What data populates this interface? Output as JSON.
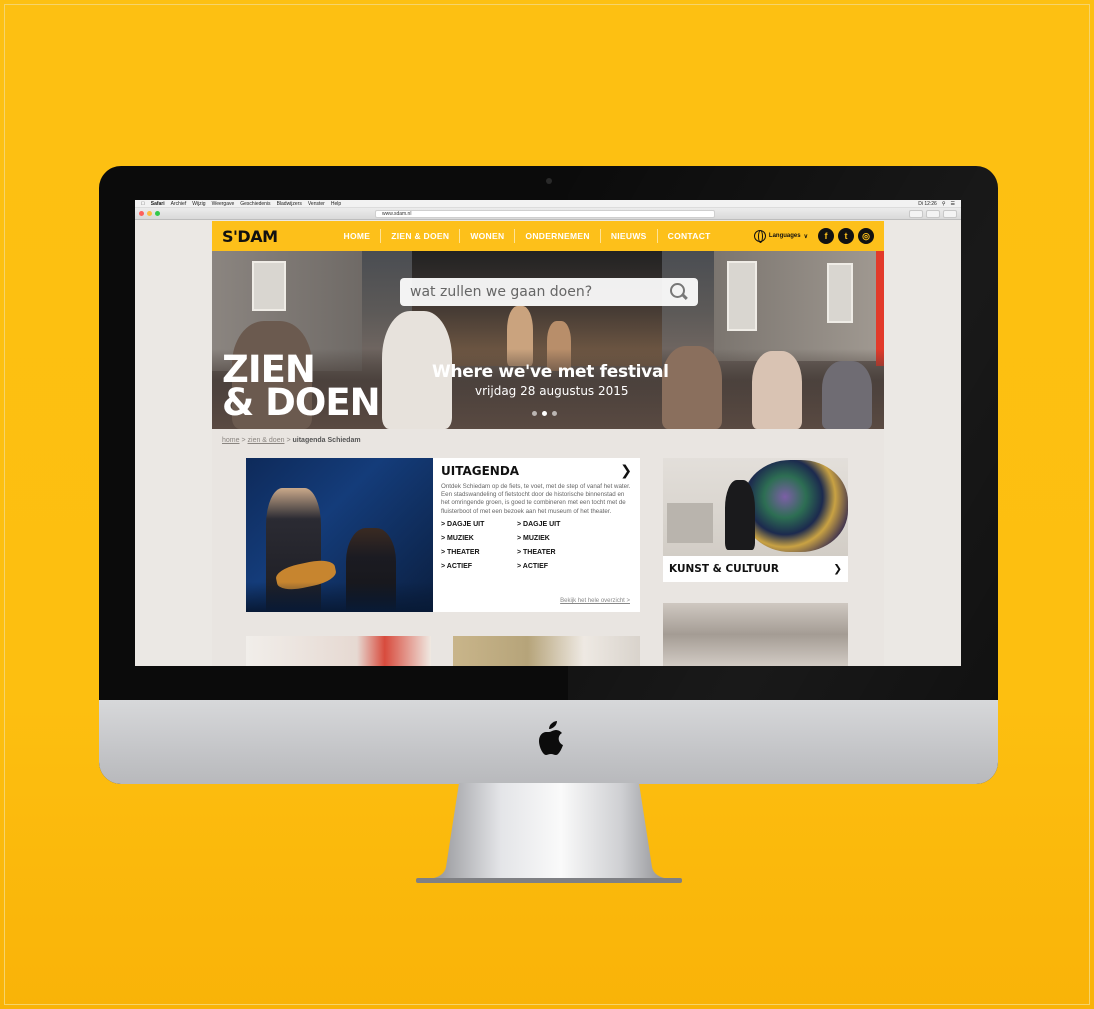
{
  "mac_menubar": {
    "app": "Safari",
    "items": [
      "Archief",
      "Wijzig",
      "Weergave",
      "Geschiedenis",
      "Bladwijzers",
      "Venster",
      "Help"
    ],
    "clock": "Di 12:26"
  },
  "browser": {
    "url": "www.sdam.nl"
  },
  "site": {
    "logo": "S'DAM",
    "nav": [
      "HOME",
      "ZIEN & DOEN",
      "WONEN",
      "ONDERNEMEN",
      "NIEUWS",
      "CONTACT"
    ],
    "languages_label": "Languages",
    "social": [
      {
        "icon": "facebook-icon",
        "glyph": "f"
      },
      {
        "icon": "twitter-icon",
        "glyph": "t"
      },
      {
        "icon": "instagram-icon",
        "glyph": "◎"
      }
    ]
  },
  "hero": {
    "search_placeholder": "wat zullen we gaan doen?",
    "title_line1": "ZIEN",
    "title_line2": "& DOEN",
    "event_title": "Where we've met festival",
    "event_date": "vrijdag 28 augustus 2015"
  },
  "breadcrumb": {
    "home": "home",
    "sep": ">",
    "section": "zien & doen",
    "current": "uitagenda Schiedam"
  },
  "uitagenda": {
    "title": "UITAGENDA",
    "description": "Ontdek Schiedam op de fiets, te voet, met de step of vanaf het water. Een stadswandeling of fietstocht door de historische binnenstad en het omringende groen, is goed te combineren met een tocht met de fluisterboot of met een bezoek aan het museum of het theater.",
    "links": [
      "> DAGJE UIT",
      "> DAGJE UIT",
      "> MUZIEK",
      "> MUZIEK",
      "> THEATER",
      "> THEATER",
      "> ACTIEF",
      "> ACTIEF"
    ],
    "overview_link": "Bekijk het hele overzicht >"
  },
  "kunst": {
    "label": "KUNST & CULTUUR"
  },
  "colors": {
    "background": "#fdc012",
    "brand_yellow": "#fdc01a",
    "page_bg": "#e9e5e1"
  }
}
